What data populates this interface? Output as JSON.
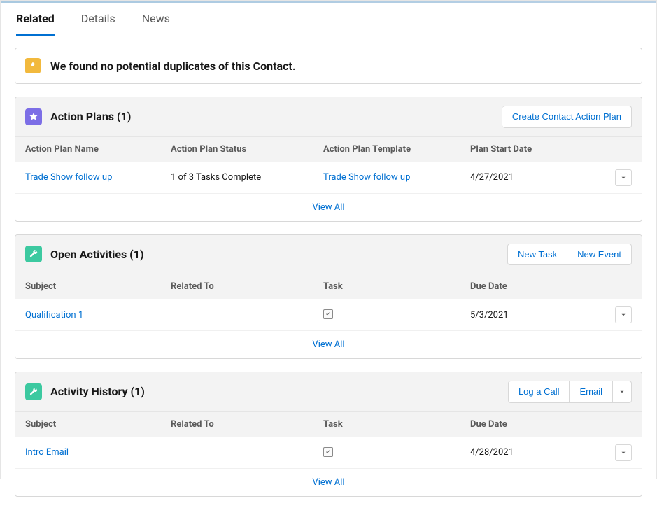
{
  "tabs": {
    "related": "Related",
    "details": "Details",
    "news": "News"
  },
  "duplicates": {
    "message": "We found no potential duplicates of this Contact."
  },
  "action_plans": {
    "title": "Action Plans (1)",
    "create_btn": "Create Contact Action Plan",
    "headers": {
      "name": "Action Plan Name",
      "status": "Action Plan Status",
      "template": "Action Plan Template",
      "start": "Plan Start Date"
    },
    "rows": [
      {
        "name": "Trade Show follow up",
        "status": "1 of 3 Tasks Complete",
        "template": "Trade Show follow up",
        "start": "4/27/2021"
      }
    ],
    "view_all": "View All"
  },
  "open_activities": {
    "title": "Open Activities (1)",
    "new_task_btn": "New Task",
    "new_event_btn": "New Event",
    "headers": {
      "subject": "Subject",
      "related": "Related To",
      "task": "Task",
      "due": "Due Date"
    },
    "rows": [
      {
        "subject": "Qualification 1",
        "related": "",
        "task_checked": true,
        "due": "5/3/2021"
      }
    ],
    "view_all": "View All"
  },
  "activity_history": {
    "title": "Activity History (1)",
    "log_call_btn": "Log a Call",
    "email_btn": "Email",
    "headers": {
      "subject": "Subject",
      "related": "Related To",
      "task": "Task",
      "due": "Due Date"
    },
    "rows": [
      {
        "subject": "Intro Email",
        "related": "",
        "task_checked": true,
        "due": "4/28/2021"
      }
    ],
    "view_all": "View All"
  }
}
